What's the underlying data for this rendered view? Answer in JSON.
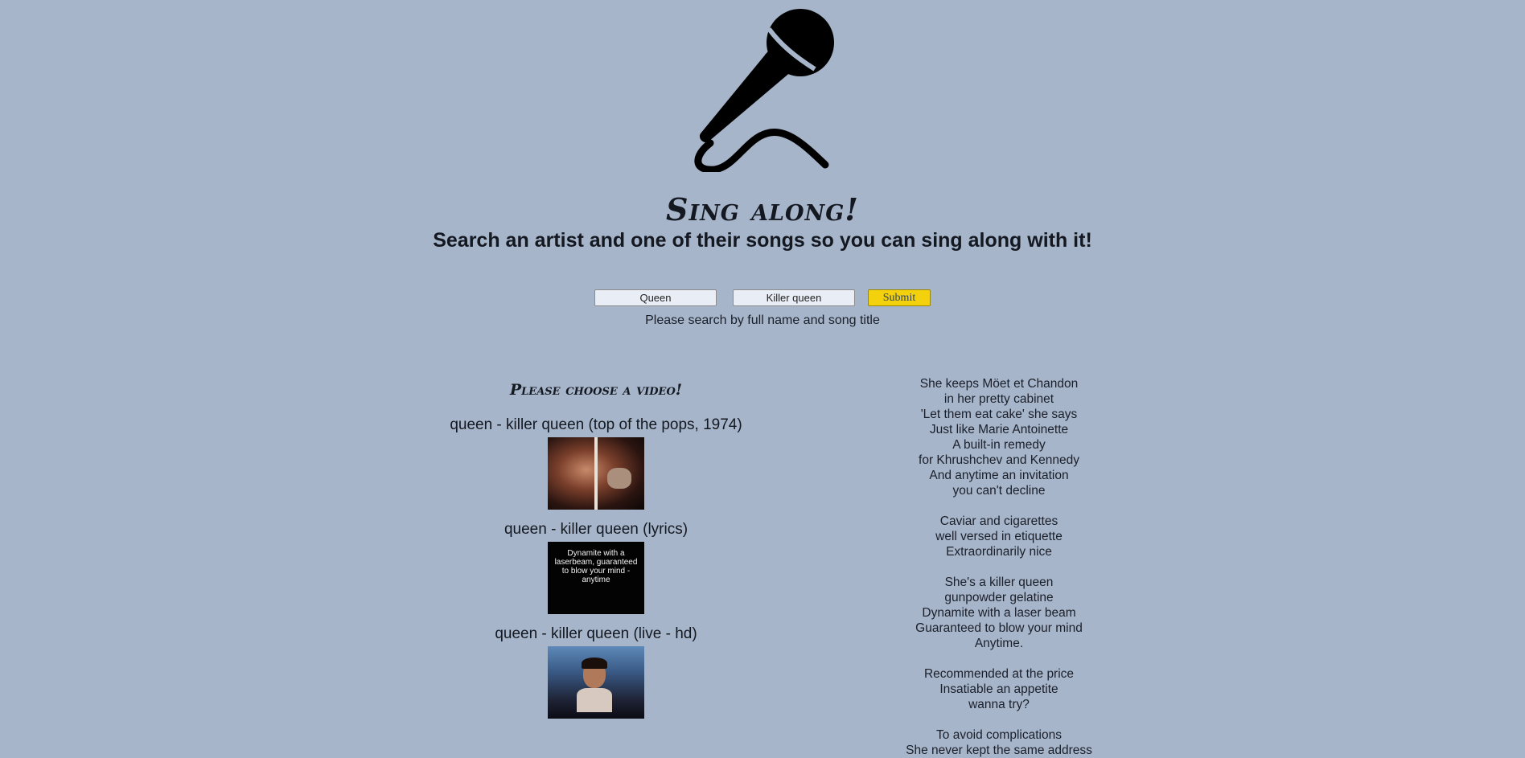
{
  "page": {
    "title": "Sing along!",
    "subtitle": "Search an artist and one of their songs so you can sing along with it!",
    "background": "#a6b5c9",
    "accent": "#f3d20d"
  },
  "search": {
    "artist_value": "Queen",
    "song_value": "Killer queen",
    "submit_label": "Submit",
    "hint": "Please search by full name and song title"
  },
  "icons": {
    "logo": "microphone-icon"
  },
  "videos": {
    "heading": "Please choose a video!",
    "items": [
      {
        "title": "queen - killer queen (top of the pops, 1974)"
      },
      {
        "title": "queen - killer queen (lyrics)",
        "thumb_text": "Dynamite with a laserbeam, guaranteed to blow your mind - anytime"
      },
      {
        "title": "queen - killer queen (live - hd)"
      }
    ]
  },
  "lyrics": {
    "lines": [
      "She keeps Möet et Chandon",
      "in her pretty cabinet",
      "'Let them eat cake' she says",
      "Just like Marie Antoinette",
      "A built-in remedy",
      "for Khrushchev and Kennedy",
      "And anytime an invitation",
      "you can't decline",
      "",
      "Caviar and cigarettes",
      "well versed in etiquette",
      "Extraordinarily nice",
      "",
      "She's a killer queen",
      "gunpowder gelatine",
      "Dynamite with a laser beam",
      "Guaranteed to blow your mind",
      "Anytime.",
      "",
      "Recommended at the price",
      "Insatiable an appetite",
      "wanna try?",
      "",
      "To avoid complications",
      "She never kept the same address"
    ]
  }
}
